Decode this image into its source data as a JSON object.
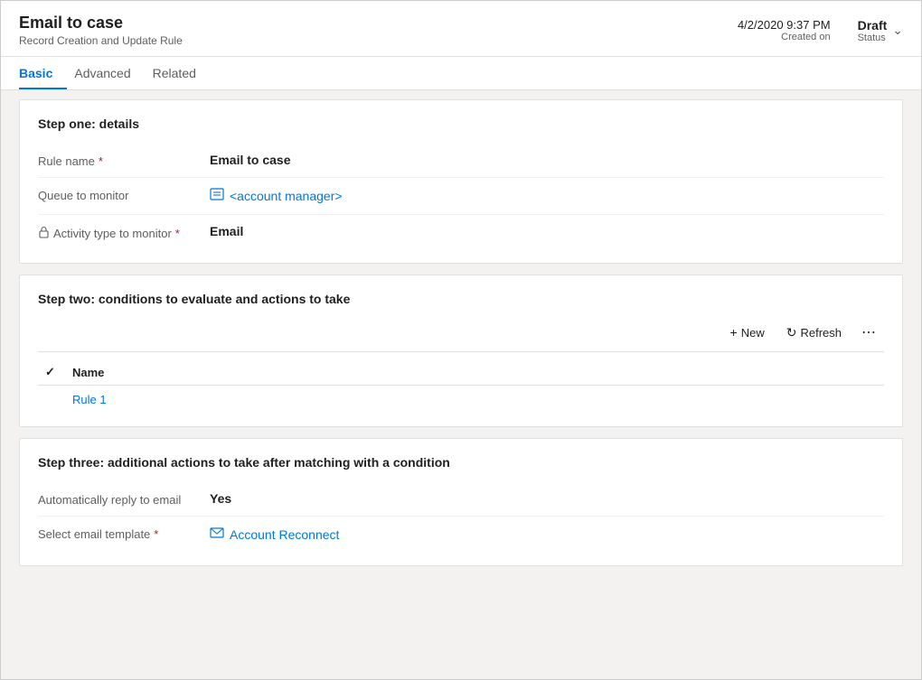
{
  "header": {
    "title": "Email to case",
    "subtitle": "Record Creation and Update Rule",
    "date": "4/2/2020 9:37 PM",
    "created_on_label": "Created on",
    "status_value": "Draft",
    "status_label": "Status"
  },
  "tabs": [
    {
      "id": "basic",
      "label": "Basic",
      "active": true
    },
    {
      "id": "advanced",
      "label": "Advanced",
      "active": false
    },
    {
      "id": "related",
      "label": "Related",
      "active": false
    }
  ],
  "step_one": {
    "title": "Step one: details",
    "fields": [
      {
        "label": "Rule name",
        "required": true,
        "value": "Email to case",
        "type": "text"
      },
      {
        "label": "Queue to monitor",
        "required": false,
        "value": "<account manager>",
        "type": "link",
        "icon": "queue"
      },
      {
        "label": "Activity type to monitor",
        "required": true,
        "value": "Email",
        "type": "text",
        "icon": "lock"
      }
    ]
  },
  "step_two": {
    "title": "Step two: conditions to evaluate and actions to take",
    "toolbar": {
      "new_label": "New",
      "refresh_label": "Refresh"
    },
    "table": {
      "columns": [
        {
          "id": "check",
          "label": ""
        },
        {
          "id": "name",
          "label": "Name"
        }
      ],
      "rows": [
        {
          "name": "Rule 1"
        }
      ]
    }
  },
  "step_three": {
    "title": "Step three: additional actions to take after matching with a condition",
    "fields": [
      {
        "label": "Automatically reply to email",
        "required": false,
        "value": "Yes",
        "type": "bold"
      },
      {
        "label": "Select email template",
        "required": true,
        "value": "Account Reconnect",
        "type": "link",
        "icon": "template"
      }
    ]
  },
  "icons": {
    "queue": "📋",
    "lock": "🔒",
    "template": "📧",
    "chevron_down": "∨",
    "plus": "+",
    "refresh": "↻",
    "more": "···",
    "check": "✓"
  }
}
